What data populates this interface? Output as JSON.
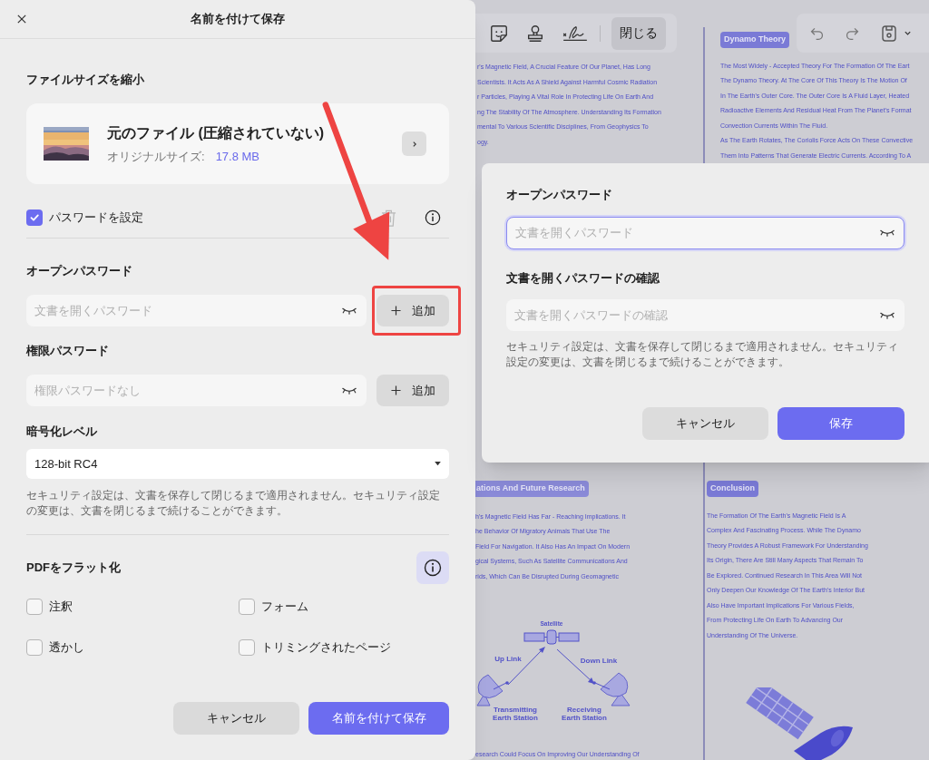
{
  "toolbar": {
    "close_button": "閉じる"
  },
  "document": {
    "left_column": {
      "lines": [
        "r's Magnetic Field, A Crucial Feature Of Our Planet, Has Long",
        "Scientists. It Acts As A Shield Against Harmful Cosmic Radiation",
        "r Particles, Playing A Vital Role In Protecting Life On Earth And",
        "ng The Stability Of The Atmosphere. Understanding Its Formation",
        "mental To Various Scientific Disciplines, From Geophysics To",
        "ogy."
      ]
    },
    "right_column": {
      "heading": "Dynamo Theory",
      "lines": [
        "The Most Widely - Accepted Theory For The Formation Of The Eart",
        "The Dynamo Theory. At The Core Of This Theory Is The Motion Of",
        "In The Earth's Outer Core. The Outer Core Is A Fluid Layer, Heated",
        "Radioactive Elements And Residual Heat From The Planet's Format",
        "Convection Currents Within The Fluid.",
        "As The Earth Rotates, The Coriolis Force Acts On These Convective",
        "Them Into Patterns That Generate Electric Currents. According To A"
      ]
    },
    "lower_left": {
      "heading": "ations And Future Research",
      "lines": [
        "h's Magnetic Field Has Far - Reaching Implications. It",
        "he Behavior Of Migratory Animals That Use The",
        "Field For Navigation. It Also Has An Impact On Modern",
        "gical Systems, Such As Satellite Communications And",
        "rids, Which Can Be Disrupted During Geomagnetic"
      ],
      "diagram": {
        "satellite": "Satellite",
        "up_link": "Up Link",
        "down_link": "Down Link",
        "transmitter": [
          "Transmitting",
          "Earth Station"
        ],
        "receiver": [
          "Receiving",
          "Earth Station"
        ]
      },
      "footer_line": "esearch Could Focus On Improving Our Understanding Of"
    },
    "lower_right": {
      "heading": "Conclusion",
      "lines": [
        "The Formation Of The Earth's Magnetic Field Is A",
        "Complex And Fascinating Process. While The Dynamo",
        "Theory Provides A Robust Framework For Understanding",
        "Its Origin, There Are Still Many Aspects That Remain To",
        "Be Explored. Continued Research In This Area Will Not",
        "Only Deepen Our Knowledge Of The Earth's Interior But",
        "Also Have Important Implications For Various Fields,",
        "From Protecting Life On Earth To Advancing Our",
        "Understanding Of The Universe."
      ]
    }
  },
  "save_as_dialog": {
    "title": "名前を付けて保存",
    "compress": {
      "heading": "ファイルサイズを縮小",
      "file_title": "元のファイル (圧縮されていない)",
      "size_label": "オリジナルサイズ:",
      "size_value": "17.8 MB"
    },
    "set_password": {
      "label": "パスワードを設定",
      "checked": true
    },
    "open_password": {
      "label": "オープンパスワード",
      "placeholder": "文書を開くパスワード",
      "add_button": "追加"
    },
    "permission_password": {
      "label": "権限パスワード",
      "placeholder": "権限パスワードなし",
      "add_button": "追加"
    },
    "encryption": {
      "label": "暗号化レベル",
      "value": "128-bit RC4"
    },
    "note": "セキュリティ設定は、文書を保存して閉じるまで適用されません。セキュリティ設定の変更は、文書を閉じるまで続けることができます。",
    "flatten": {
      "heading": "PDFをフラット化",
      "options": [
        {
          "label": "注釈",
          "checked": false
        },
        {
          "label": "フォーム",
          "checked": false
        },
        {
          "label": "透かし",
          "checked": false
        },
        {
          "label": "トリミングされたページ",
          "checked": false
        }
      ]
    },
    "buttons": {
      "cancel": "キャンセル",
      "save": "名前を付けて保存"
    }
  },
  "password_dialog": {
    "open_label": "オープンパスワード",
    "open_placeholder": "文書を開くパスワード",
    "confirm_label": "文書を開くパスワードの確認",
    "confirm_placeholder": "文書を開くパスワードの確認",
    "note": "セキュリティ設定は、文書を保存して閉じるまで適用されません。セキュリティ設定の変更は、文書を閉じるまで続けることができます。",
    "buttons": {
      "cancel": "キャンセル",
      "save": "保存"
    }
  }
}
